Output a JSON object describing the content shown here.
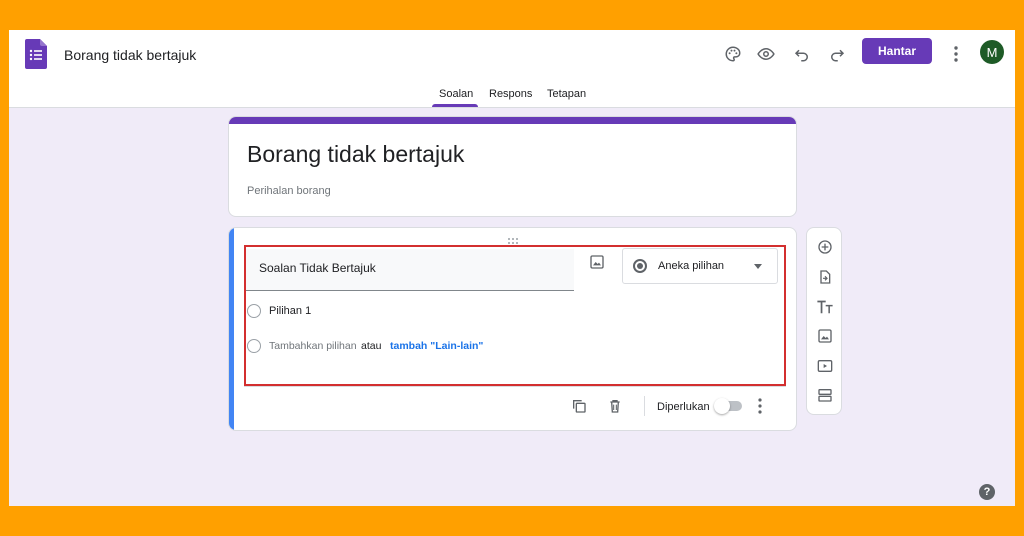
{
  "header": {
    "doc_title": "Borang tidak bertajuk",
    "send_label": "Hantar",
    "avatar_initial": "M"
  },
  "tabs": [
    {
      "label": "Soalan",
      "active": true
    },
    {
      "label": "Respons",
      "active": false
    },
    {
      "label": "Tetapan",
      "active": false
    }
  ],
  "form": {
    "title": "Borang tidak bertajuk",
    "description": "Perihalan borang"
  },
  "question": {
    "title": "Soalan Tidak Bertajuk",
    "type_label": "Aneka pilihan",
    "option_1": "Pilihan 1",
    "add_option": "Tambahkan pilihan",
    "or_text": "atau",
    "add_other": "tambah \"Lain-lain\"",
    "required_label": "Diperlukan",
    "required_on": false
  },
  "help_label": "?",
  "colors": {
    "accent": "#673ab7",
    "outer_frame": "#ffa000",
    "highlight": "#d32f2f",
    "link": "#1a73e8",
    "active_card": "#4285f4",
    "background": "#f0ebf8"
  },
  "icons": {
    "toolbar": [
      "palette-icon",
      "preview-eye-icon",
      "undo-icon",
      "redo-icon",
      "more-vert-icon"
    ],
    "side_tools": [
      "add-question-icon",
      "import-questions-icon",
      "add-title-icon",
      "add-image-icon",
      "add-video-icon",
      "add-section-icon"
    ],
    "footer": [
      "duplicate-icon",
      "delete-icon",
      "more-vert-icon"
    ]
  }
}
